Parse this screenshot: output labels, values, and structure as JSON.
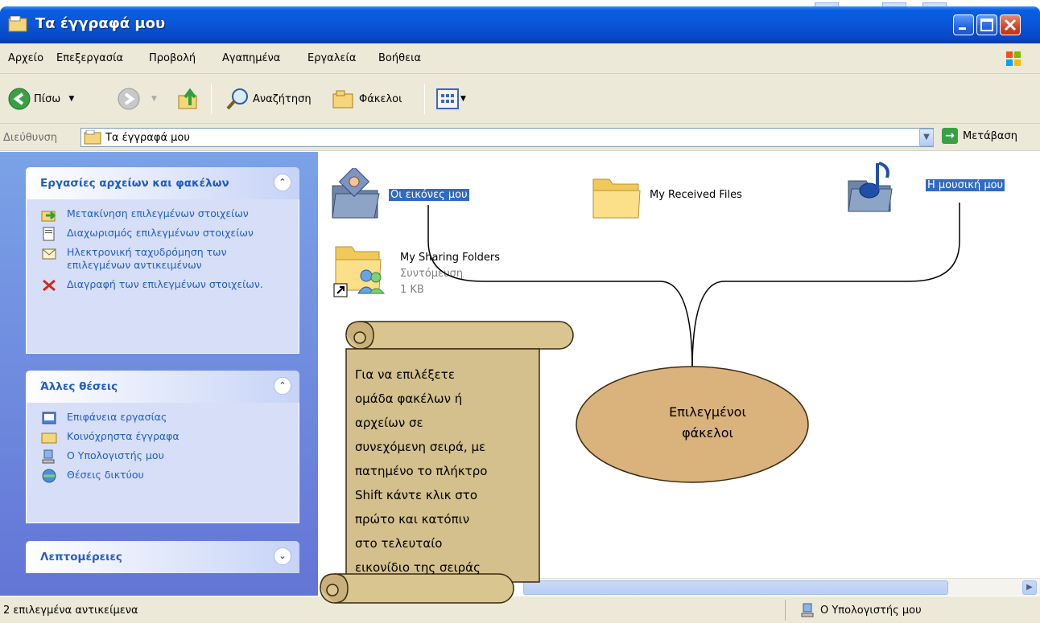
{
  "window": {
    "title": "Τα έγγραφά μου"
  },
  "menu": [
    "Αρχείο",
    "Επεξεργασία",
    "Προβολή",
    "Αγαπημένα",
    "Εργαλεία",
    "Βοήθεια"
  ],
  "toolbar": {
    "back_label": "Πίσω",
    "search_label": "Αναζήτηση",
    "folders_label": "Φάκελοι"
  },
  "address": {
    "label": "Διεύθυνση",
    "value": "Τα έγγραφά μου",
    "go_label": "Μετάβαση"
  },
  "panels": {
    "file_tasks": {
      "title": "Εργασίες αρχείων και φακέλων",
      "items": [
        "Μετακίνηση επιλεγμένων στοιχείων",
        "Διαχωρισμός επιλεγμένων στοιχείων",
        "Ηλεκτρονική ταχυδρόμηση των επιλεγμένων αντικειμένων",
        "Διαγραφή των επιλεγμένων στοιχείων."
      ]
    },
    "other_places": {
      "title": "Άλλες θέσεις",
      "items": [
        "Επιφάνεια εργασίας",
        "Κοινόχρηστα έγγραφα",
        "Ο Υπολογιστής μου",
        "Θέσεις δικτύου"
      ]
    },
    "details": {
      "title": "Λεπτομέρειες"
    }
  },
  "files": [
    {
      "name": "Οι εικόνες μου",
      "selected": true
    },
    {
      "name": "My Received Files",
      "selected": false
    },
    {
      "name": "Η μουσική μου",
      "selected": true
    },
    {
      "name": "My Sharing Folders",
      "type": "Συντόμευση",
      "size": "1 KB",
      "selected": false
    }
  ],
  "annotations": {
    "scroll_lines": [
      "Για να επιλέξετε",
      "ομάδα φακέλων ή",
      "αρχείων σε",
      "συνεχόμενη σειρά, με",
      "πατημένο το πλήκτρο",
      "Shift κάντε κλικ στο",
      "πρώτο και κατόπιν",
      "στο τελευταίο",
      "εικονίδιο της σειράς"
    ],
    "callout_lines": [
      "Επιλεγμένοι",
      "φάκελοι"
    ]
  },
  "status": {
    "left": "2 επιλεγμένα αντικείμενα",
    "right": "Ο Υπολογιστής μου"
  },
  "colors": {
    "title_bar": "#0a55d8",
    "task_pane": "#7ba2e7",
    "link": "#215dc6",
    "selection": "#316ac5",
    "scroll": "#d4c08c",
    "callout": "#d9b27c"
  }
}
